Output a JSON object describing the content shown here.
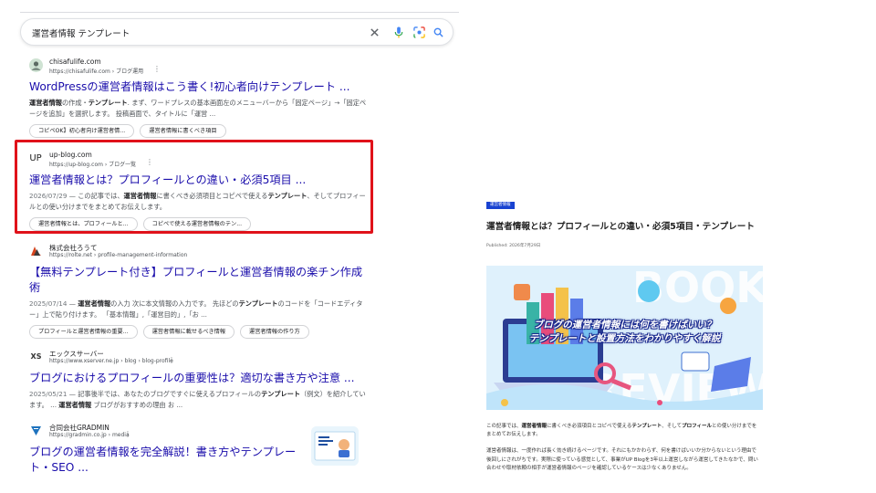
{
  "search": {
    "query": "運営者情報 テンプレート"
  },
  "results": [
    {
      "site": "chisafulife.com",
      "url": "https://chisafulife.com › ブログ運用",
      "title": "WordPressの運営者情報はこう書く!初心者向けテンプレート ...",
      "snippet_html": "<b>運営者情報</b>の作成・<b>テンプレート</b>. まず、ワードプレスの基本画面左のメニューバーから「固定ページ」→「固定ページを追加」を選択します。 投稿画面で、タイトルに「運営 ...",
      "chips": [
        "コピペOK】初心者向け運営者情...",
        "運営者情報に書くべき項目"
      ]
    },
    {
      "site": "up-blog.com",
      "url": "https://up-blog.com › ブログ一覧",
      "favicon_text": "UP",
      "title": "運営者情報とは？プロフィールとの違い・必須5項目 ...",
      "date": "2026/07/29",
      "snippet_html": "この記事では、<b>運営者情報</b>に書くべき必須項目とコピペで使える<b>テンプレート</b>、そしてプロフィールとの使い分けまでをまとめてお伝えします。",
      "chips": [
        "運営者情報とは、プロフィールと...",
        "コピペで使える運営者情報のテン..."
      ]
    },
    {
      "site": "株式会社ろうて",
      "url": "https://rolte.net › profile-management-information",
      "title": "【無料テンプレート付き】プロフィールと運営者情報の楽チン作成術",
      "date": "2025/07/14",
      "snippet_html": "<b>運営者情報</b>の入力 次に本文情報の入力です。 先ほどの<b>テンプレート</b>のコードを「コードエディター」上で貼り付けます。 「基本情報」,「運営目的」,「お ...",
      "chips": [
        "プロフィールと運営者情報の重要...",
        "運営者情報に載せるべき情報",
        "運営者情報の作り方"
      ]
    },
    {
      "site": "エックスサーバー",
      "url": "https://www.xserver.ne.jp › blog › blog-profile",
      "favicon_text": "XS",
      "title": "ブログにおけるプロフィールの重要性は？適切な書き方や注意 ...",
      "date": "2025/05/21",
      "snippet_html": "記事後半では、あなたのブログですぐに使えるプロフィールの<b>テンプレート</b>（例文）を紹介しています。 ... <b>運営者情報</b> ブログがおすすめの理由 お ..."
    },
    {
      "site": "合同会社GRADMIN",
      "url": "https://gradmin.co.jp › media",
      "title": "ブログの運営者情報を完全解説！書き方やテンプレート・SEO ..."
    }
  ],
  "article": {
    "category": "運営者情報",
    "title": "運営者情報とは？プロフィールとの違い・必須5項目・テンプレート",
    "published": "Published: 2026年7月29日",
    "eyecatch_line1": "ブログの運営者情報には何を書けばいい？",
    "eyecatch_line2": "テンプレートと設置方法をわかりやすく解説",
    "eyecatch_bg_top": "BOOK",
    "eyecatch_bg_bottom": "REVIEW",
    "para1_html": "この記事では、<b>運営者情報</b>に書くべき必須項目とコピペで使える<b>テンプレート</b>、そして<b>プロフィール</b>との使い分けまでをまとめてお伝えします。",
    "para2": "運営者情報は、一度作れば長く効き続けるページです。それにもかかわらず、何を書けばいいか分からないという理由で後回しにされがちです。実際に使っている感覚として、事業がUP Blogを3年以上運営しながら運営してきたなかで、問い合わせや取材依頼の相手が運営者情報のページを確認しているケースは少なくありません。"
  },
  "colors": {
    "link": "#1a0dab",
    "highlight": "#e0121a",
    "badge": "#1842d1"
  }
}
